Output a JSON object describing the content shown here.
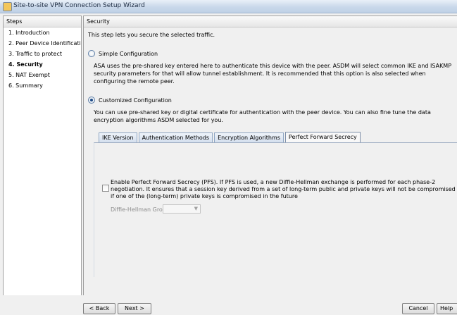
{
  "window": {
    "title": "Site-to-site VPN Connection Setup Wizard"
  },
  "steps": {
    "header": "Steps",
    "items": [
      {
        "label": "1.  Introduction",
        "active": false
      },
      {
        "label": "2.  Peer Device Identificatio",
        "active": false
      },
      {
        "label": "3.  Traffic to protect",
        "active": false
      },
      {
        "label": "4.  Security",
        "active": true
      },
      {
        "label": "5.  NAT Exempt",
        "active": false
      },
      {
        "label": "6.  Summary",
        "active": false
      }
    ]
  },
  "main": {
    "header": "Security",
    "intro": "This step lets you secure the selected traffic.",
    "simple": {
      "label": "Simple Configuration",
      "selected": false,
      "description": "ASA uses the pre-shared key entered here to authenticate this device with the peer. ASDM will select common IKE and ISAKMP security parameters for that will allow tunnel establishment. It is recommended that this option is also selected when configuring the remote peer."
    },
    "customized": {
      "label": "Customized Configuration",
      "selected": true,
      "description": "You can use pre-shared key or digital certificate for authentication with the peer device. You can also fine tune the data encryption algorithms ASDM selected for you."
    },
    "tabs": [
      {
        "label": "IKE Version",
        "selected": false
      },
      {
        "label": "Authentication Methods",
        "selected": false
      },
      {
        "label": "Encryption Algorithms",
        "selected": false
      },
      {
        "label": "Perfect Forward Secrecy",
        "selected": true
      }
    ],
    "pfs": {
      "checked": false,
      "text": "Enable Perfect Forward Secrecy (PFS). If PFS is used, a new Diffie-Hellman exchange is performed for each phase-2 negotiation. It ensures that a session key derived from a set of long-term public and private keys will not be compromised if one of the (long-term) private keys is compromised in the future",
      "dh_label": "Diffie-Hellman Group:",
      "dh_value": ""
    }
  },
  "buttons": {
    "back": "< Back",
    "next": "Next >",
    "cancel": "Cancel",
    "help": "Help"
  }
}
